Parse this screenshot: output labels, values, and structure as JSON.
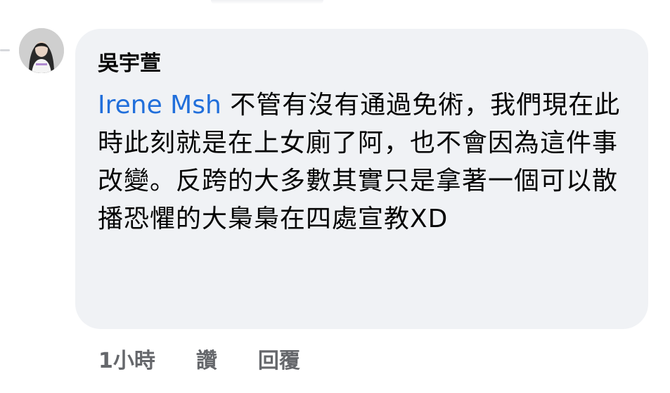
{
  "comment": {
    "author": "吳宇萱",
    "mention": "Irene Msh",
    "text": " 不管有沒有通過免術，我們現在此時此刻就是在上女廁了阿，也不會因為這件事改變。反跨的大多數其實只是拿著一個可以散播恐懼的大梟梟在四處宣教XD"
  },
  "actions": {
    "time": "1小時",
    "like_label": "讚",
    "reply_label": "回覆"
  },
  "colors": {
    "bubble": "#f0f2f5",
    "mention": "#216fdb",
    "meta": "#65676b",
    "text": "#050505"
  }
}
